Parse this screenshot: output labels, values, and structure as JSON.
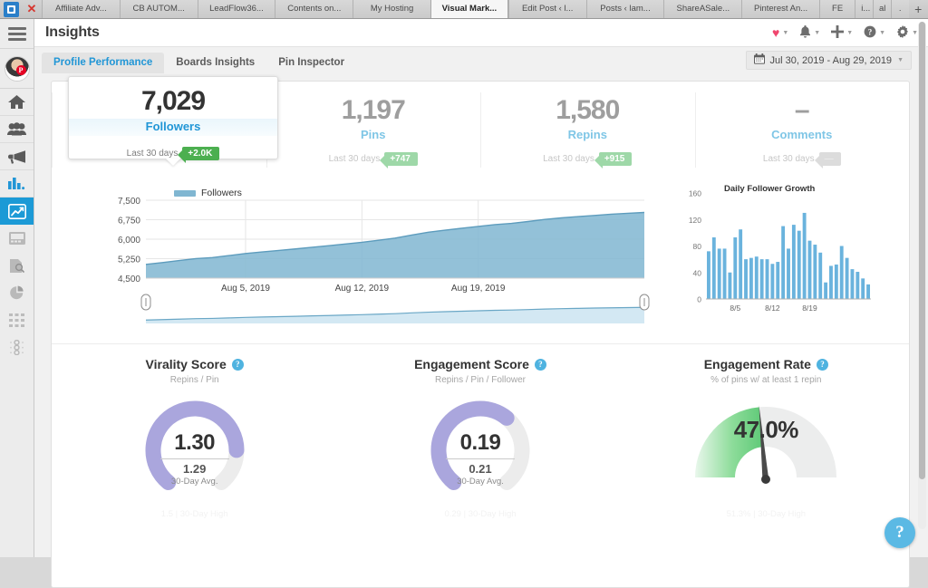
{
  "browser": {
    "app_icon": "outlook-icon",
    "close_label": "✕",
    "new_tab_label": "+",
    "tabs": [
      {
        "label": "Affiliate Adv...",
        "active": false,
        "size": "std"
      },
      {
        "label": "CB AUTOM...",
        "active": false,
        "size": "std"
      },
      {
        "label": "LeadFlow36...",
        "active": false,
        "size": "std"
      },
      {
        "label": "Contents on...",
        "active": false,
        "size": "std"
      },
      {
        "label": "My Hosting",
        "active": false,
        "size": "std"
      },
      {
        "label": "Visual Mark...",
        "active": true,
        "size": "std"
      },
      {
        "label": "Edit Post ‹ l...",
        "active": false,
        "size": "std"
      },
      {
        "label": "Posts ‹ lam...",
        "active": false,
        "size": "std"
      },
      {
        "label": "ShareASale...",
        "active": false,
        "size": "std"
      },
      {
        "label": "Pinterest An...",
        "active": false,
        "size": "std"
      },
      {
        "label": "FE",
        "active": false,
        "size": "sm"
      },
      {
        "label": "i...",
        "active": false,
        "size": "xs"
      },
      {
        "label": "al",
        "active": false,
        "size": "xs"
      },
      {
        "label": ".",
        "active": false,
        "size": "xs"
      }
    ]
  },
  "rail": {
    "menu_label": "menu",
    "items": [
      {
        "name": "home",
        "icon": "home-icon",
        "state": "normal"
      },
      {
        "name": "audience",
        "icon": "people-icon",
        "state": "normal"
      },
      {
        "name": "promote",
        "icon": "megaphone-icon",
        "state": "normal"
      },
      {
        "name": "analytics",
        "icon": "bar-chart-icon",
        "state": "blue"
      },
      {
        "name": "insights",
        "icon": "line-chart-icon",
        "state": "active"
      },
      {
        "name": "campaigns",
        "icon": "board-icon",
        "state": "dim"
      },
      {
        "name": "reports",
        "icon": "report-icon",
        "state": "dim"
      },
      {
        "name": "pie",
        "icon": "pie-chart-icon",
        "state": "dim"
      },
      {
        "name": "grid",
        "icon": "grid-icon",
        "state": "dim"
      },
      {
        "name": "tracking",
        "icon": "traffic-icon",
        "state": "dim"
      }
    ]
  },
  "header": {
    "title": "Insights",
    "actions": [
      {
        "name": "favorites",
        "icon": "heart-icon",
        "glyph": "♥",
        "accent": "#f0466e"
      },
      {
        "name": "notifications",
        "icon": "bell-icon",
        "glyph": "🔔"
      },
      {
        "name": "create",
        "icon": "plus-icon",
        "glyph": "✛"
      },
      {
        "name": "help",
        "icon": "question-icon",
        "glyph": "?"
      },
      {
        "name": "settings",
        "icon": "gear-icon",
        "glyph": "✸"
      }
    ]
  },
  "subnav": {
    "tabs": [
      {
        "label": "Profile Performance",
        "selected": true
      },
      {
        "label": "Boards Insights",
        "selected": false
      },
      {
        "label": "Pin Inspector",
        "selected": false
      }
    ],
    "date_range": "Jul 30, 2019 - Aug 29, 2019",
    "calendar_icon": "calendar-icon"
  },
  "kpis": [
    {
      "value": "7,029",
      "label": "Followers",
      "period": "Last 30 days",
      "delta": "+2.0K",
      "highlighted": true
    },
    {
      "value": "1,197",
      "label": "Pins",
      "period": "Last 30 days",
      "delta": "+747",
      "highlighted": false
    },
    {
      "value": "1,580",
      "label": "Repins",
      "period": "Last 30 days",
      "delta": "+915",
      "highlighted": false
    },
    {
      "value": "–",
      "label": "Comments",
      "period": "Last 30 days",
      "delta": "—",
      "highlighted": false
    }
  ],
  "chart_data": [
    {
      "type": "area",
      "name": "followers-over-time",
      "title": "",
      "legend": [
        "Followers"
      ],
      "legend_position": "top-left",
      "xlabel": "",
      "ylabel": "",
      "ylim": [
        4500,
        7500
      ],
      "yticks": [
        "4,500",
        "5,250",
        "6,000",
        "6,750",
        "7,500"
      ],
      "xticks": [
        "Aug 5, 2019",
        "Aug 12, 2019",
        "Aug 19, 2019"
      ],
      "grid": true,
      "color": "#80b6d1",
      "x": [
        "Jul 30",
        "Jul 31",
        "Aug 1",
        "Aug 2",
        "Aug 3",
        "Aug 4",
        "Aug 5",
        "Aug 6",
        "Aug 7",
        "Aug 8",
        "Aug 9",
        "Aug 10",
        "Aug 11",
        "Aug 12",
        "Aug 13",
        "Aug 14",
        "Aug 15",
        "Aug 16",
        "Aug 17",
        "Aug 18",
        "Aug 19",
        "Aug 20",
        "Aug 21",
        "Aug 22",
        "Aug 23",
        "Aug 24",
        "Aug 25",
        "Aug 26",
        "Aug 27",
        "Aug 28",
        "Aug 29"
      ],
      "values": [
        5030,
        5100,
        5178,
        5253,
        5293,
        5370,
        5450,
        5510,
        5565,
        5625,
        5690,
        5750,
        5815,
        5880,
        5960,
        6040,
        6160,
        6270,
        6345,
        6420,
        6490,
        6560,
        6610,
        6680,
        6760,
        6820,
        6870,
        6915,
        6960,
        6995,
        7029
      ],
      "has_range_slider": true
    },
    {
      "type": "bar",
      "name": "daily-follower-growth",
      "title": "Daily Follower Growth",
      "xlabel": "",
      "ylabel": "",
      "ylim": [
        0,
        160
      ],
      "yticks": [
        "0",
        "40",
        "80",
        "120",
        "160"
      ],
      "xticks": [
        "8/5",
        "8/12",
        "8/19"
      ],
      "grid": false,
      "color": "#6ab3dd",
      "categories": [
        "7/31",
        "8/1",
        "8/2",
        "8/3",
        "8/4",
        "8/5",
        "8/6",
        "8/7",
        "8/8",
        "8/9",
        "8/10",
        "8/11",
        "8/12",
        "8/13",
        "8/14",
        "8/15",
        "8/16",
        "8/17",
        "8/18",
        "8/19",
        "8/20",
        "8/21",
        "8/22",
        "8/23",
        "8/24",
        "8/25",
        "8/26",
        "8/27",
        "8/28",
        "8/29"
      ],
      "values": [
        72,
        93,
        76,
        76,
        40,
        93,
        105,
        60,
        62,
        64,
        60,
        60,
        53,
        56,
        110,
        76,
        112,
        103,
        130,
        88,
        82,
        70,
        25,
        50,
        52,
        80,
        62,
        45,
        41,
        31,
        22
      ]
    }
  ],
  "gauges": [
    {
      "name": "virality-score",
      "title": "Virality Score",
      "subtitle": "Repins / Pin",
      "value": "1.30",
      "avg_value": "1.29",
      "avg_label": "30-Day Avg.",
      "high_label": "1.5 | 30-Day High",
      "fill_ratio": 0.82,
      "color": "#aaa6dd",
      "track": "#ececec",
      "style": "arc"
    },
    {
      "name": "engagement-score",
      "title": "Engagement Score",
      "subtitle": "Repins / Pin / Follower",
      "value": "0.19",
      "avg_value": "0.21",
      "avg_label": "30-Day Avg.",
      "high_label": "0.29 | 30-Day High",
      "fill_ratio": 0.64,
      "color": "#aaa6dd",
      "track": "#ececec",
      "style": "arc"
    },
    {
      "name": "engagement-rate",
      "title": "Engagement Rate",
      "subtitle": "% of pins w/ at least 1 repin",
      "value": "47.0%",
      "avg_value": "",
      "avg_label": "",
      "high_label": "51.3% | 30-Day High",
      "fill_ratio": 0.47,
      "color": "#6ccf7e",
      "track": "#ececec",
      "style": "needle"
    }
  ],
  "help_button": {
    "glyph": "?",
    "name": "help-fab"
  }
}
